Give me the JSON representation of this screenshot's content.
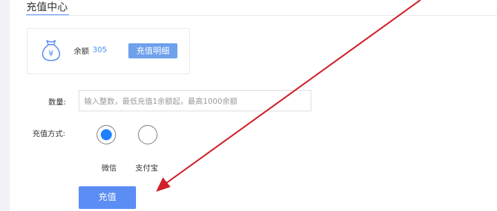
{
  "header": {
    "title": "充值中心"
  },
  "balance_card": {
    "icon": "money-bag-icon",
    "icon_symbol": "¥",
    "balance_label": "余额",
    "balance_value": "305",
    "details_button_label": "充值明细"
  },
  "form": {
    "quantity_label": "数量:",
    "quantity_placeholder": "输入整数，最低充值1余额起，最高1000余额",
    "quantity_value": "",
    "payment_method_label": "充值方式:",
    "payment_options": [
      {
        "label": "微信",
        "selected": true
      },
      {
        "label": "支付宝",
        "selected": false
      }
    ],
    "submit_label": "充值"
  },
  "colors": {
    "accent": "#4a8ef8",
    "button": "#5b8df4",
    "radio_selected": "#1e80ff",
    "annotation_arrow": "#d0202a"
  }
}
